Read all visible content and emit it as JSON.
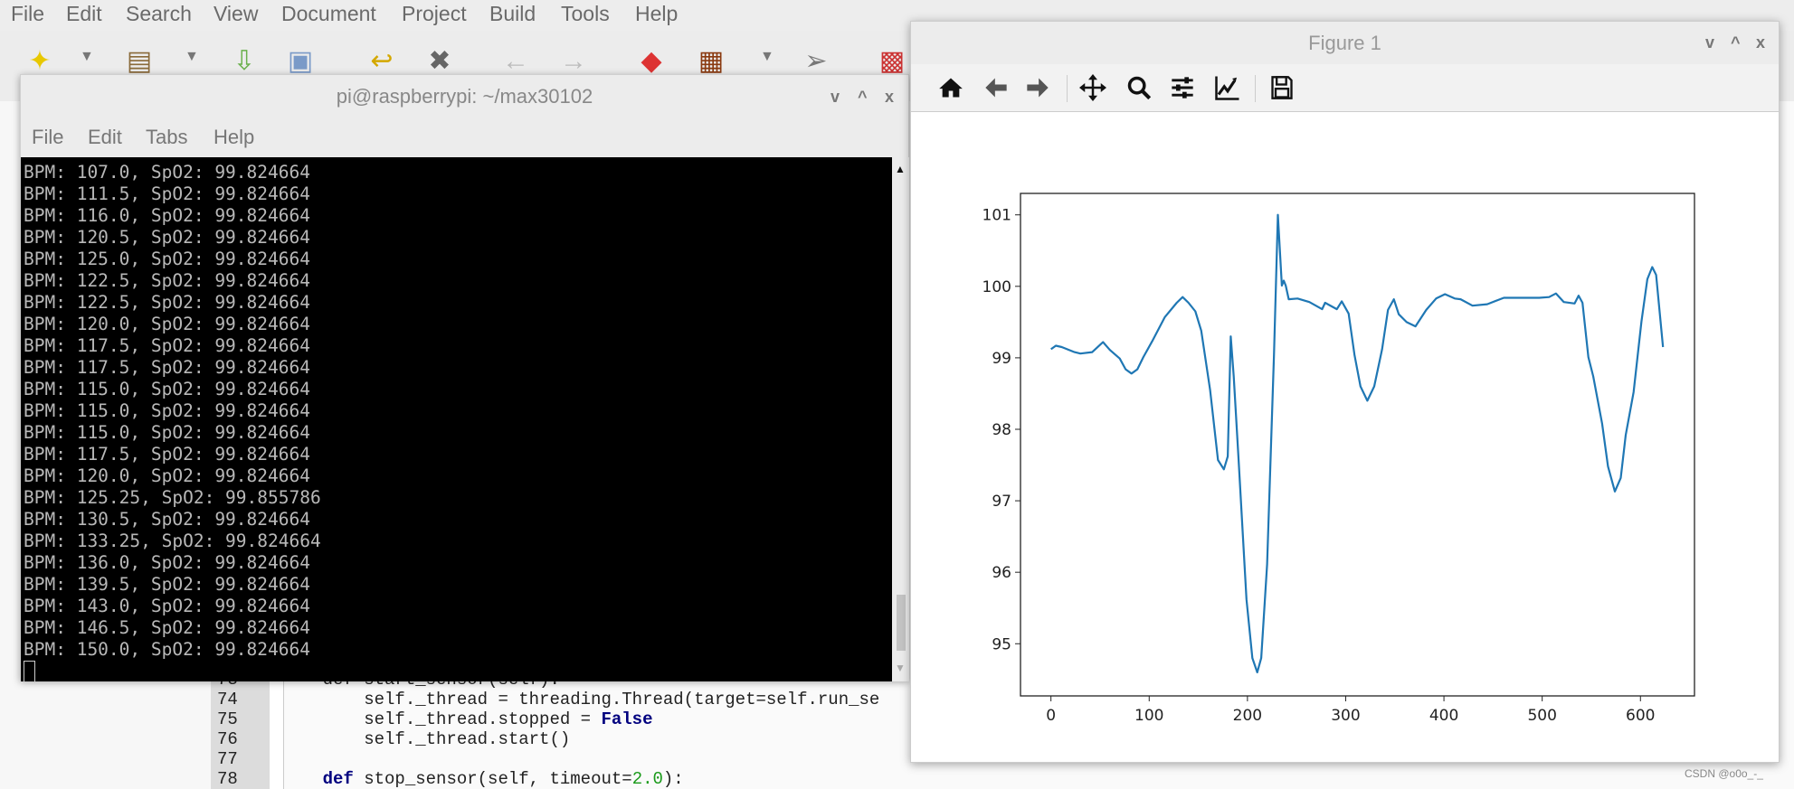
{
  "geany": {
    "menu": [
      "File",
      "Edit",
      "Search",
      "View",
      "Document",
      "Project",
      "Build",
      "Tools",
      "Help"
    ],
    "code_lines": [
      {
        "n": "73",
        "text": "    def start_sensor(self):"
      },
      {
        "n": "74",
        "text": "        self._thread = threading.Thread(target=self.run_se"
      },
      {
        "n": "75",
        "pre": "        self._thread.stopped = ",
        "kw": "False"
      },
      {
        "n": "76",
        "text": "        self._thread.start()"
      },
      {
        "n": "77",
        "text": ""
      },
      {
        "n": "78",
        "kwpre": "def",
        "mid": " stop_sensor(self, timeout=",
        "numv": "2.0",
        "post": "):"
      }
    ]
  },
  "terminal": {
    "title": "pi@raspberrypi: ~/max30102",
    "window_buttons": [
      "v",
      "^",
      "x"
    ],
    "menu": [
      "File",
      "Edit",
      "Tabs",
      "Help"
    ],
    "lines": [
      "BPM: 107.0, SpO2: 99.824664",
      "BPM: 111.5, SpO2: 99.824664",
      "BPM: 116.0, SpO2: 99.824664",
      "BPM: 120.5, SpO2: 99.824664",
      "BPM: 125.0, SpO2: 99.824664",
      "BPM: 122.5, SpO2: 99.824664",
      "BPM: 122.5, SpO2: 99.824664",
      "BPM: 120.0, SpO2: 99.824664",
      "BPM: 117.5, SpO2: 99.824664",
      "BPM: 117.5, SpO2: 99.824664",
      "BPM: 115.0, SpO2: 99.824664",
      "BPM: 115.0, SpO2: 99.824664",
      "BPM: 115.0, SpO2: 99.824664",
      "BPM: 117.5, SpO2: 99.824664",
      "BPM: 120.0, SpO2: 99.824664",
      "BPM: 125.25, SpO2: 99.855786",
      "BPM: 130.5, SpO2: 99.824664",
      "BPM: 133.25, SpO2: 99.824664",
      "BPM: 136.0, SpO2: 99.824664",
      "BPM: 139.5, SpO2: 99.824664",
      "BPM: 143.0, SpO2: 99.824664",
      "BPM: 146.5, SpO2: 99.824664",
      "BPM: 150.0, SpO2: 99.824664"
    ]
  },
  "figure": {
    "title": "Figure 1",
    "window_buttons": [
      "v",
      "^",
      "x"
    ],
    "toolbar": [
      "home-icon",
      "back-arrow-icon",
      "forward-arrow-icon",
      "pan-icon",
      "zoom-icon",
      "subplots-icon",
      "edit-axes-icon",
      "save-icon"
    ]
  },
  "chart_data": {
    "type": "line",
    "color": "#1f77b4",
    "xlim": [
      -31,
      655
    ],
    "ylim": [
      94.27,
      101.3
    ],
    "xticks": [
      0,
      100,
      200,
      300,
      400,
      500,
      600
    ],
    "yticks": [
      95,
      96,
      97,
      98,
      99,
      100,
      101
    ],
    "grid": false,
    "x": [
      0,
      5,
      11,
      24,
      30,
      42,
      53,
      60,
      70,
      76,
      82,
      88,
      94,
      103,
      116,
      128,
      134,
      140,
      147,
      153,
      162,
      170,
      176,
      180,
      183,
      186,
      191,
      199,
      205,
      210,
      214,
      220,
      227,
      231,
      235,
      237,
      239,
      242,
      251,
      263,
      276,
      279,
      291,
      296,
      303,
      309,
      315,
      322,
      329,
      337,
      343,
      349,
      354,
      362,
      371,
      382,
      392,
      401,
      411,
      417,
      429,
      444,
      461,
      497,
      507,
      514,
      522,
      533,
      537,
      541,
      547,
      552,
      561,
      567,
      574,
      580,
      585,
      593,
      601,
      607,
      612,
      616,
      623
    ],
    "y": [
      99.12,
      99.17,
      99.15,
      99.08,
      99.06,
      99.08,
      99.22,
      99.11,
      98.99,
      98.84,
      98.78,
      98.84,
      99.01,
      99.23,
      99.57,
      99.77,
      99.85,
      99.77,
      99.65,
      99.38,
      98.55,
      97.57,
      97.44,
      97.62,
      99.3,
      98.74,
      97.57,
      95.62,
      94.8,
      94.6,
      94.8,
      96.11,
      99.04,
      101.0,
      100.01,
      100.08,
      100.01,
      99.82,
      99.83,
      99.78,
      99.68,
      99.77,
      99.68,
      99.79,
      99.62,
      99.04,
      98.6,
      98.4,
      98.6,
      99.12,
      99.67,
      99.82,
      99.61,
      99.5,
      99.44,
      99.67,
      99.83,
      99.89,
      99.83,
      99.82,
      99.73,
      99.75,
      99.84,
      99.84,
      99.85,
      99.9,
      99.78,
      99.76,
      99.87,
      99.77,
      99.01,
      98.74,
      98.08,
      97.48,
      97.13,
      97.32,
      97.92,
      98.52,
      99.51,
      100.1,
      100.27,
      100.16,
      99.15
    ]
  },
  "watermark": "CSDN @o0o_-_"
}
